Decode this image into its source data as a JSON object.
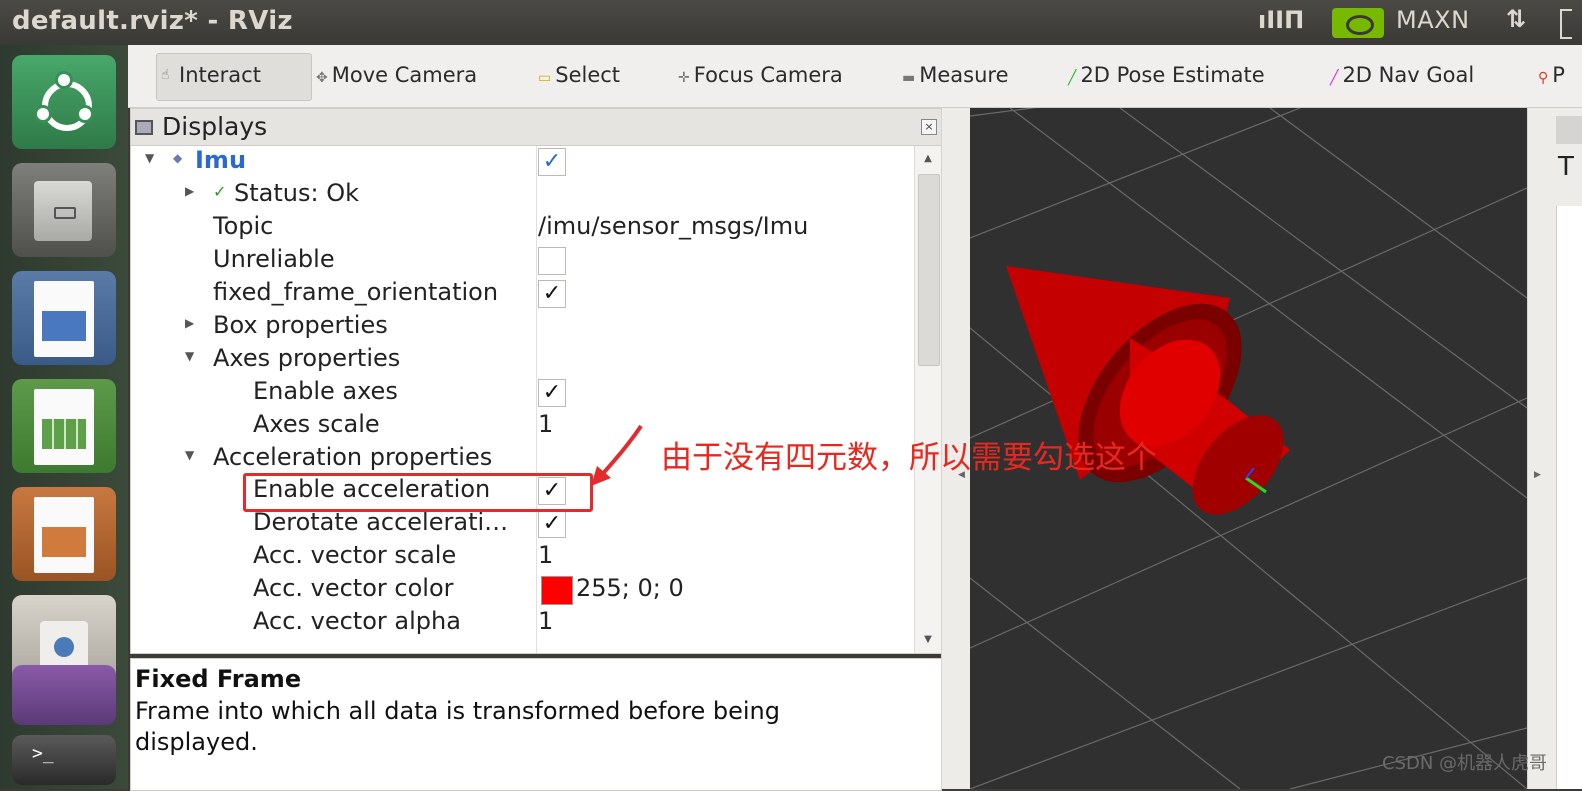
{
  "window": {
    "title": "default.rviz* - RViz"
  },
  "tray": {
    "mode": "MAXN",
    "net_glyph": "ıIIΠ",
    "updown_glyph": "⇅"
  },
  "toolbar": {
    "tools": [
      {
        "label": "Interact",
        "icon": "hand-icon"
      },
      {
        "label": "Move Camera",
        "icon": "move-icon"
      },
      {
        "label": "Select",
        "icon": "select-icon"
      },
      {
        "label": "Focus Camera",
        "icon": "focus-icon"
      },
      {
        "label": "Measure",
        "icon": "ruler-icon"
      },
      {
        "label": "2D Pose Estimate",
        "icon": "pose-arrow-icon"
      },
      {
        "label": "2D Nav Goal",
        "icon": "goal-arrow-icon"
      },
      {
        "label": "P",
        "icon": "pin-icon"
      }
    ]
  },
  "displays": {
    "title": "Displays",
    "rows": [
      {
        "name": "Imu",
        "value": "",
        "checked": true
      },
      {
        "name": "Status: Ok",
        "value": ""
      },
      {
        "name": "Topic",
        "value": "/imu/sensor_msgs/Imu"
      },
      {
        "name": "Unreliable",
        "value": "",
        "checked": false
      },
      {
        "name": "fixed_frame_orientation",
        "value": "",
        "checked": true
      },
      {
        "name": "Box properties",
        "value": ""
      },
      {
        "name": "Axes properties",
        "value": ""
      },
      {
        "name": "Enable axes",
        "value": "",
        "checked": true
      },
      {
        "name": "Axes scale",
        "value": "1"
      },
      {
        "name": "Acceleration properties",
        "value": ""
      },
      {
        "name": "Enable acceleration",
        "value": "",
        "checked": true
      },
      {
        "name": "Derotate accelerati…",
        "value": "",
        "checked": true
      },
      {
        "name": "Acc. vector scale",
        "value": "1"
      },
      {
        "name": "Acc. vector color",
        "value": "255; 0; 0",
        "color": "#ff0000"
      },
      {
        "name": "Acc. vector alpha",
        "value": "1"
      }
    ]
  },
  "description": {
    "title": "Fixed Frame",
    "body": "Frame into which all data is transformed before being displayed."
  },
  "right_panel": {
    "letter": "T"
  },
  "annotation": {
    "text": "由于没有四元数，所以需要勾选这个",
    "color": "#e8281f"
  },
  "watermark": "CSDN @机器人虎哥",
  "check_glyph": "✓"
}
